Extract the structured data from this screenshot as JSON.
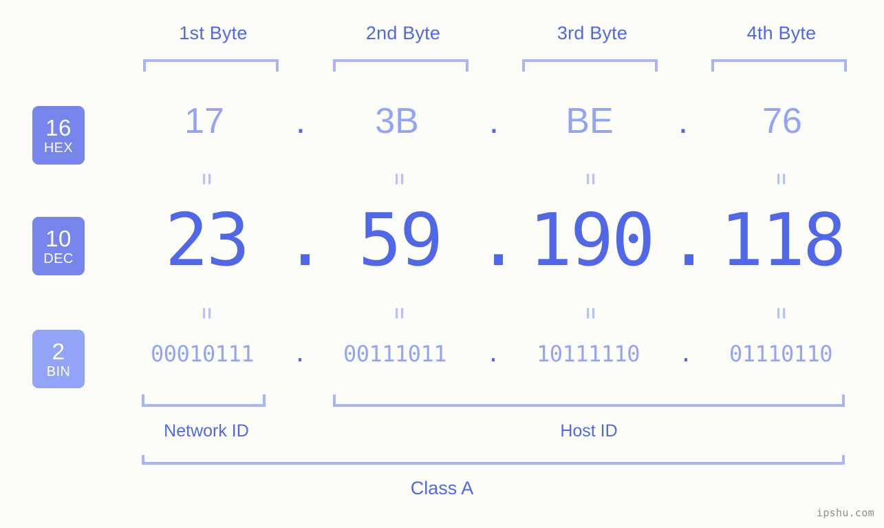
{
  "background_color": "#fcfdf8",
  "accent_color": "#5068e8",
  "accent_light_color": "#93a3f8",
  "bracket_color": "#aab4f7",
  "byte_headers": [
    {
      "label": "1st Byte"
    },
    {
      "label": "2nd Byte"
    },
    {
      "label": "3rd Byte"
    },
    {
      "label": "4th Byte"
    }
  ],
  "rows": [
    {
      "badge_number": "16",
      "badge_name": "HEX",
      "values": [
        "17",
        "3B",
        "BE",
        "76"
      ],
      "separator": "."
    },
    {
      "badge_number": "10",
      "badge_name": "DEC",
      "values": [
        "23",
        "59",
        "190",
        "118"
      ],
      "separator": "."
    },
    {
      "badge_number": "2",
      "badge_name": "BIN",
      "values": [
        "00010111",
        "00111011",
        "10111110",
        "01110110"
      ],
      "separator": "."
    }
  ],
  "equals_glyph": "=",
  "sections": {
    "network_id": "Network ID",
    "host_id": "Host ID"
  },
  "class_label": "Class A",
  "watermark": "ipshu.com"
}
